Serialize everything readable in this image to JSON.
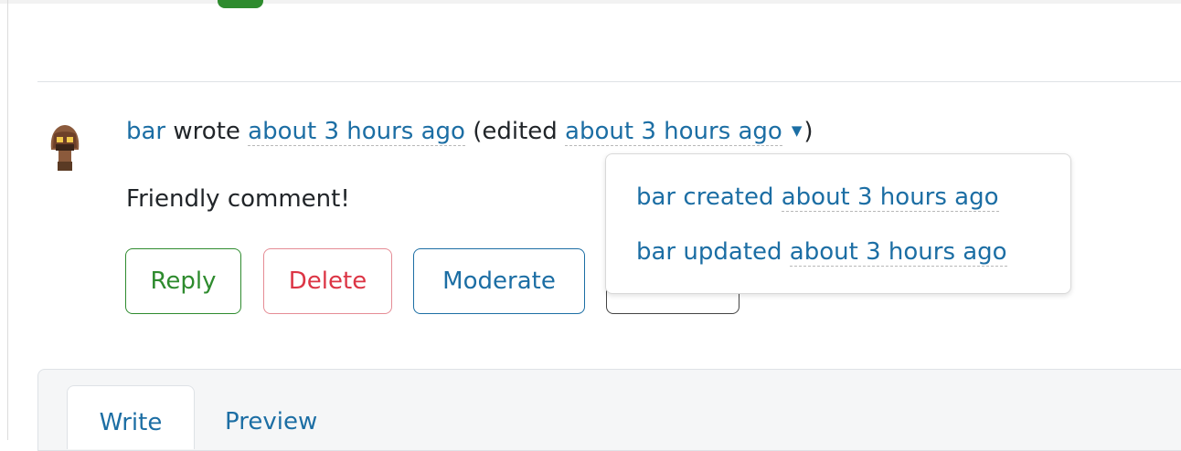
{
  "comment": {
    "author": "bar",
    "wrote_text": "wrote",
    "created_time": "about 3 hours ago",
    "edited_prefix": "(edited",
    "edited_time": "about 3 hours ago",
    "edited_suffix": ")",
    "body": "Friendly comment!"
  },
  "actions": {
    "reply": "Reply",
    "delete": "Delete",
    "moderate": "Moderate"
  },
  "edit_history": [
    {
      "user": "bar",
      "action": "created",
      "time": "about 3 hours ago"
    },
    {
      "user": "bar",
      "action": "updated",
      "time": "about 3 hours ago"
    }
  ],
  "editor": {
    "tabs": [
      "Write",
      "Preview"
    ]
  },
  "colors": {
    "link": "#1c6ea4",
    "reply": "#2e8b2e",
    "delete": "#dc3545"
  }
}
